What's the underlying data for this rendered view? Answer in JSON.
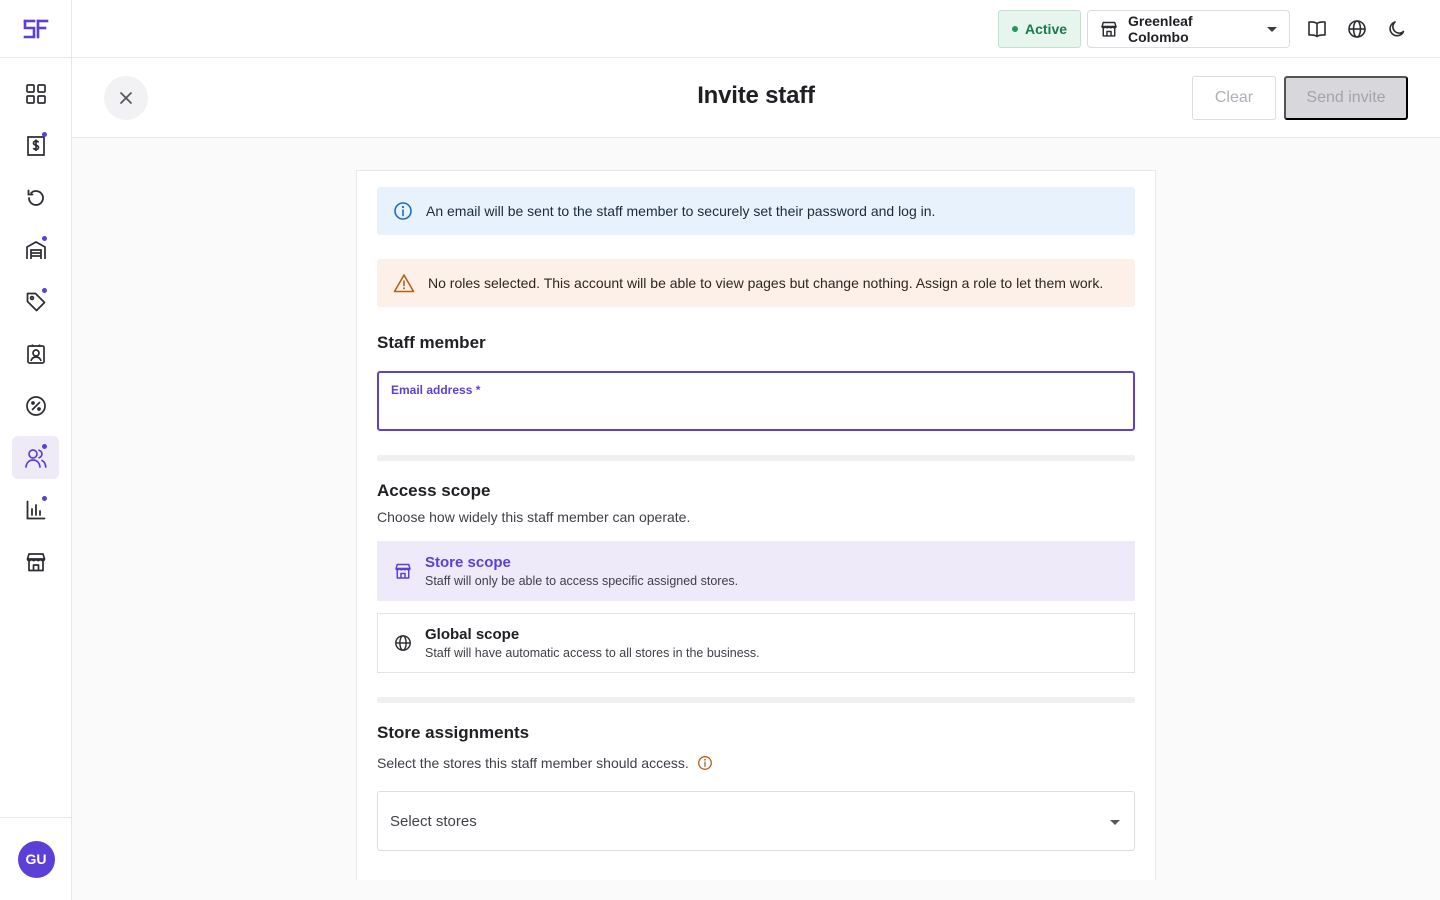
{
  "brand": {
    "logo_text": "SF",
    "accent": "#5b3fd6"
  },
  "sidebar": {
    "items": [
      {
        "icon": "dashboard-grid-icon",
        "active": false,
        "dot": false
      },
      {
        "icon": "invoice-dollar-icon",
        "active": false,
        "dot": true
      },
      {
        "icon": "history-icon",
        "active": false,
        "dot": false
      },
      {
        "icon": "inventory-icon",
        "active": false,
        "dot": true
      },
      {
        "icon": "tag-icon",
        "active": false,
        "dot": true
      },
      {
        "icon": "contact-icon",
        "active": false,
        "dot": false
      },
      {
        "icon": "discount-icon",
        "active": false,
        "dot": false
      },
      {
        "icon": "staff-icon",
        "active": true,
        "dot": true
      },
      {
        "icon": "reports-icon",
        "active": false,
        "dot": true
      },
      {
        "icon": "store-icon",
        "active": false,
        "dot": false
      }
    ],
    "avatar_initials": "GU"
  },
  "topbar": {
    "status": "Active",
    "store_name": "Greenleaf Colombo",
    "icons": [
      "book-icon",
      "globe-icon",
      "moon-icon"
    ]
  },
  "header": {
    "title": "Invite staff",
    "clear_label": "Clear",
    "send_label": "Send invite"
  },
  "alerts": {
    "info": "An email will be sent to the staff member to securely set their password and log in.",
    "warning": "No roles selected. This account will be able to view pages but change nothing. Assign a role to let them work."
  },
  "staff_member": {
    "title": "Staff member",
    "email_label": "Email address *",
    "email_value": ""
  },
  "access_scope": {
    "title": "Access scope",
    "subtitle": "Choose how widely this staff member can operate.",
    "options": [
      {
        "title": "Store scope",
        "desc": "Staff will only be able to access specific assigned stores.",
        "selected": true
      },
      {
        "title": "Global scope",
        "desc": "Staff will have automatic access to all stores in the business.",
        "selected": false
      }
    ]
  },
  "store_assignments": {
    "title": "Store assignments",
    "subtitle": "Select the stores this staff member should access.",
    "placeholder": "Select stores"
  }
}
